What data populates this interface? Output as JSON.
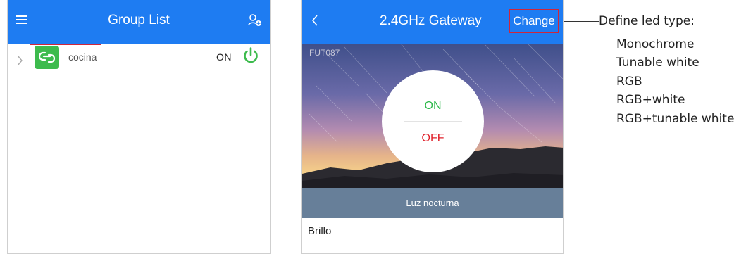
{
  "group_list": {
    "title": "Group List",
    "rows": [
      {
        "name": "cocina",
        "state": "ON"
      }
    ]
  },
  "gateway": {
    "title": "2.4GHz Gateway",
    "change_label": "Change",
    "model": "FUT087",
    "on_label": "ON",
    "off_label": "OFF",
    "mode_label": "Luz nocturna",
    "brightness_label": "Brillo"
  },
  "annotation": {
    "title": "Define led type:",
    "items": [
      "Monochrome",
      "Tunable white",
      "RGB",
      "RGB+white",
      "RGB+tunable white"
    ]
  },
  "colors": {
    "header_blue": "#1e7cf2",
    "power_green": "#3dbb4d",
    "on_green": "#2db84a",
    "off_red": "#e0202a",
    "highlight_red": "#d0263a",
    "mode_bar": "#677f99"
  },
  "icons": {
    "menu": "hamburger-menu-icon",
    "group": "group-settings-icon",
    "chevron": "chevron-right-icon",
    "group_badge": "link-icon",
    "power": "power-icon",
    "back": "chevron-left-icon"
  }
}
